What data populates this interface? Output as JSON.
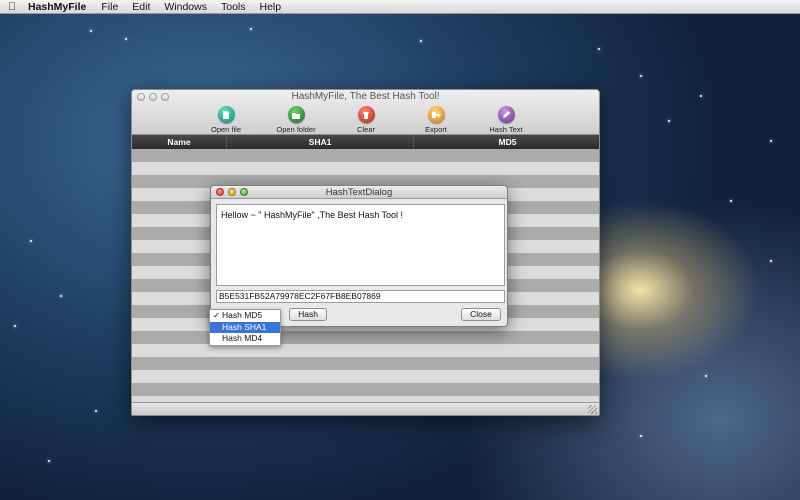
{
  "menubar": {
    "apple_glyph": "",
    "app_name": "HashMyFile",
    "items": [
      "File",
      "Edit",
      "Windows",
      "Tools",
      "Help"
    ]
  },
  "window": {
    "title": "HashMyFile, The Best Hash Tool!",
    "toolbar": [
      {
        "label": "Open file",
        "icon": "open-file-icon",
        "color": "#16a085"
      },
      {
        "label": "Open folder",
        "icon": "open-folder-icon",
        "color": "#1e7a32"
      },
      {
        "label": "Clear",
        "icon": "trash-icon",
        "color": "#c0392b"
      },
      {
        "label": "Export",
        "icon": "export-icon",
        "color": "#e67e22"
      },
      {
        "label": "Hash Text",
        "icon": "pencil-icon",
        "color": "#7d3c98"
      }
    ],
    "columns": [
      "Name",
      "SHA1",
      "MD5"
    ]
  },
  "dialog": {
    "title": "HashTextDialog",
    "input_text": "Hellow ~ \" HashMyFile\" ,The Best Hash Tool !",
    "hash_output": "B5E531FB52A79978EC2F67FB8EB07869",
    "hash_button": "Hash",
    "close_button": "Close"
  },
  "algorithm_menu": {
    "checked": "Hash MD5",
    "highlighted": "Hash SHA1",
    "items": [
      "Hash MD5",
      "Hash SHA1",
      "Hash MD4"
    ],
    "check_glyph": "✓"
  }
}
